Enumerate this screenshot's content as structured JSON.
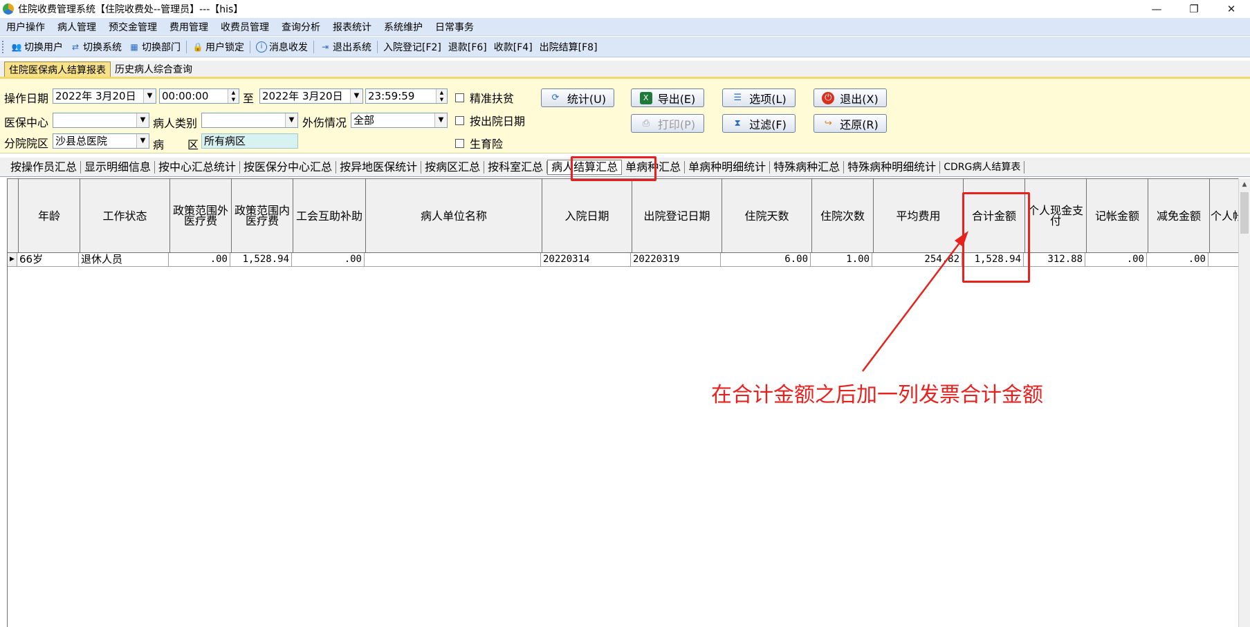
{
  "window": {
    "title": "住院收费管理系统【住院收费处--管理员】---【his】",
    "controls": {
      "minimize": "—",
      "maximize": "❐",
      "close": "✕"
    }
  },
  "menubar": [
    "用户操作",
    "病人管理",
    "预交金管理",
    "费用管理",
    "收费员管理",
    "查询分析",
    "报表统计",
    "系统维护",
    "日常事务"
  ],
  "toolbar": [
    {
      "label": "切换用户",
      "icon": "users-icon"
    },
    {
      "label": "切换系统",
      "icon": "switch-system-icon"
    },
    {
      "label": "切换部门",
      "icon": "department-icon"
    },
    {
      "label": "用户锁定",
      "icon": "lock-user-icon"
    },
    {
      "label": "消息收发",
      "icon": "info-icon"
    },
    {
      "label": "退出系统",
      "icon": "exit-icon"
    },
    {
      "label": "入院登记[F2]"
    },
    {
      "label": "退款[F6]"
    },
    {
      "label": "收款[F4]"
    },
    {
      "label": "出院结算[F8]"
    }
  ],
  "top_tabs": [
    {
      "label": "住院医保病人结算报表",
      "active": true
    },
    {
      "label": "历史病人综合查询",
      "active": false
    }
  ],
  "filters": {
    "op_date_label": "操作日期",
    "date_from": "2022年 3月20日",
    "time_from": "00:00:00",
    "to_label": "至",
    "date_to": "2022年 3月20日",
    "time_to": "23:59:59",
    "insurance_center_label": "医保中心",
    "insurance_center_value": "",
    "patient_type_label": "病人类别",
    "patient_type_value": "",
    "injury_label": "外伤情况",
    "injury_value": "全部",
    "branch_label": "分院院区",
    "branch_value": "沙县总医院",
    "ward_label_1": "病",
    "ward_label_2": "区",
    "ward_value": "所有病区",
    "check_poverty": "精准扶贫",
    "check_discharge_date": "按出院日期",
    "check_maternity": "生育险"
  },
  "buttons": {
    "stats": "统计(U)",
    "export": "导出(E)",
    "options": "选项(L)",
    "exit": "退出(X)",
    "print": "打印(P)",
    "filter": "过滤(F)",
    "restore": "还原(R)"
  },
  "sub_tabs": [
    {
      "label": "按操作员汇总"
    },
    {
      "label": "显示明细信息"
    },
    {
      "label": "按中心汇总统计"
    },
    {
      "label": "按医保分中心汇总"
    },
    {
      "label": "按异地医保统计"
    },
    {
      "label": "按病区汇总"
    },
    {
      "label": "按科室汇总"
    },
    {
      "label": "病人结算汇总",
      "active": true
    },
    {
      "label": "单病种汇总"
    },
    {
      "label": "单病种明细统计"
    },
    {
      "label": "特殊病种汇总"
    },
    {
      "label": "特殊病种明细统计"
    },
    {
      "label": "CDRG病人结算表"
    }
  ],
  "grid": {
    "columns": [
      "年龄",
      "工作状态",
      "政策范围外医疗费",
      "政策范围内医疗费",
      "工会互助补助",
      "病人单位名称",
      "入院日期",
      "出院登记日期",
      "住院天数",
      "住院次数",
      "平均费用",
      "合计金额",
      "个人现金支付",
      "记帐金额",
      "减免金额",
      "个人帐"
    ],
    "rows": [
      [
        "66岁",
        "退休人员",
        ".00",
        "1,528.94",
        ".00",
        "",
        "20220314",
        "20220319",
        "6.00",
        "1.00",
        "254.82",
        "1,528.94",
        "312.88",
        ".00",
        ".00",
        ""
      ]
    ]
  },
  "annotation": {
    "text": "在合计金额之后加一列发票合计金额",
    "color": "#e8201e"
  }
}
